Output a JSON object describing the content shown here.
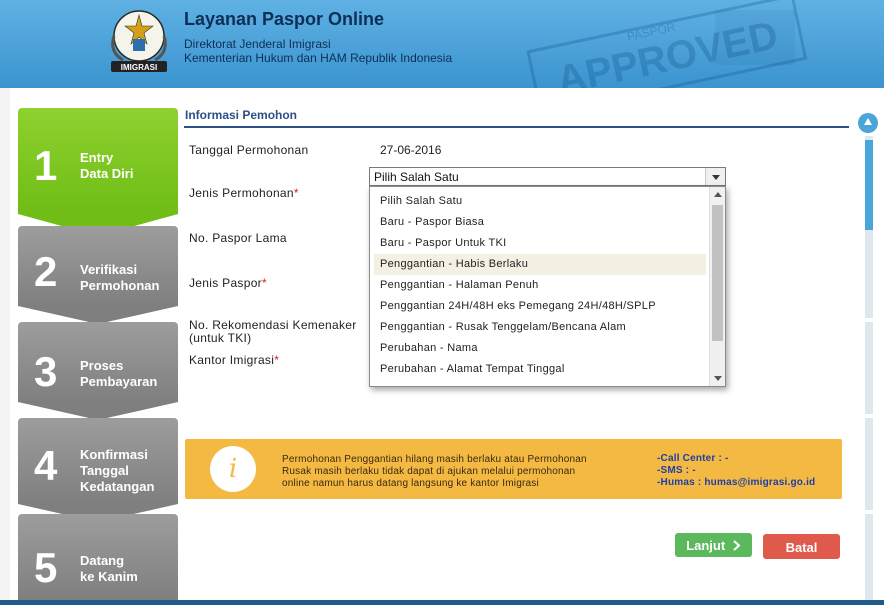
{
  "header": {
    "title": "Layanan Paspor Online",
    "subtitle_1": "Direktorat Jenderal Imigrasi",
    "subtitle_2": "Kementerian Hukum dan HAM Republik Indonesia",
    "logo_text": "IMIGRASI",
    "stamp_text": "APPROVED",
    "stamp_small_text": "PASPOR"
  },
  "steps": [
    {
      "num": "1",
      "line1": "Entry",
      "line2": "Data Diri",
      "line3": "",
      "state": "active"
    },
    {
      "num": "2",
      "line1": "Verifikasi",
      "line2": "Permohonan",
      "line3": "",
      "state": "inactive"
    },
    {
      "num": "3",
      "line1": "Proses",
      "line2": "Pembayaran",
      "line3": "",
      "state": "inactive"
    },
    {
      "num": "4",
      "line1": "Konfirmasi",
      "line2": "Tanggal",
      "line3": "Kedatangan",
      "state": "inactive"
    },
    {
      "num": "5",
      "line1": "Datang",
      "line2": "ke Kanim",
      "line3": "",
      "state": "inactive"
    }
  ],
  "form": {
    "section_title": "Informasi Pemohon",
    "tanggal_label": "Tanggal Permohonan",
    "tanggal_value": "27-06-2016",
    "jenis_permohonan_label": "Jenis Permohonan",
    "jenis_permohonan_value": "Pilih Salah Satu",
    "paspor_lama_label": "No. Paspor Lama",
    "jenis_paspor_label": "Jenis Paspor",
    "rekomendasi_label_1": "No. Rekomendasi Kemenaker",
    "rekomendasi_label_2": "(untuk TKI)",
    "kantor_label": "Kantor Imigrasi",
    "required_mark": "*"
  },
  "dropdown": {
    "options": [
      "Pilih Salah Satu",
      "Baru - Paspor Biasa",
      "Baru - Paspor Untuk TKI",
      "Penggantian - Habis Berlaku",
      "Penggantian - Halaman Penuh",
      "Penggantian 24H/48H eks Pemegang 24H/48H/SPLP",
      "Penggantian - Rusak Tenggelam/Bencana Alam",
      "Perubahan - Nama",
      "Perubahan - Alamat Tempat Tinggal"
    ],
    "highlighted": "Penggantian - Habis Berlaku"
  },
  "info": {
    "icon": "i",
    "line1": "Permohonan Penggantian hilang masih berlaku atau Permohonan",
    "line2": "Rusak masih berlaku tidak dapat di ajukan melalui permohonan",
    "line3": "online namun harus datang langsung ke kantor Imigrasi",
    "contact1": "-Call Center : -",
    "contact2": "-SMS : -",
    "contact3": "-Humas : humas@imigrasi.go.id"
  },
  "buttons": {
    "next": "Lanjut",
    "next_icon": "chevron-right-icon",
    "cancel": "Batal"
  },
  "colors": {
    "header_blue": "#3b94cf",
    "active_step": "#6fbd16",
    "inactive_step": "#8c8c8c",
    "section_title": "#2d4f86",
    "info_bg": "#f4b942",
    "next_btn": "#5cb85c",
    "cancel_btn": "#e05a4c",
    "required": "#d32020"
  }
}
